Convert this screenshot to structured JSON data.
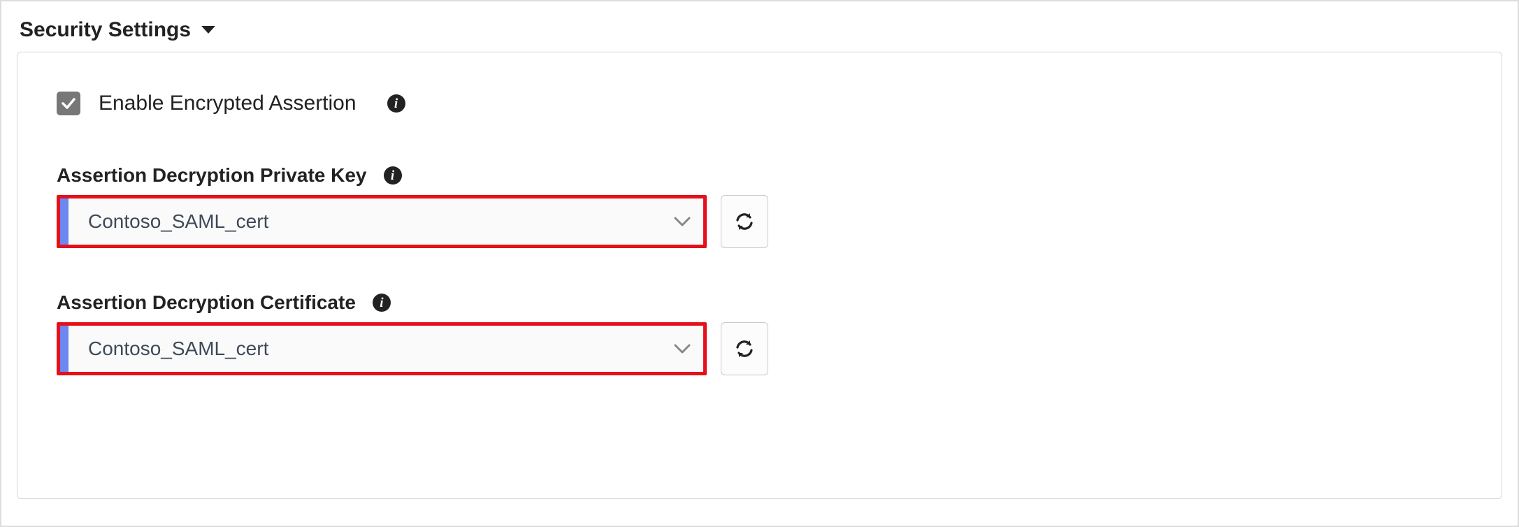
{
  "section": {
    "title": "Security Settings"
  },
  "enable": {
    "label": "Enable Encrypted Assertion",
    "checked": true
  },
  "fields": {
    "privateKey": {
      "label": "Assertion Decryption Private Key",
      "value": "Contoso_SAML_cert"
    },
    "certificate": {
      "label": "Assertion Decryption Certificate",
      "value": "Contoso_SAML_cert"
    }
  },
  "colors": {
    "highlight": "#e4111b",
    "accent": "#6d87f0",
    "checkbox": "#777777"
  }
}
